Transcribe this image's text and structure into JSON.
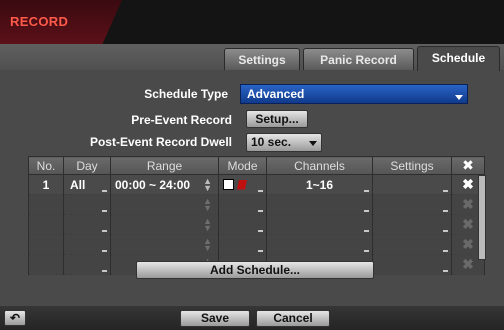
{
  "window": {
    "title": "RECORD"
  },
  "tabs": [
    {
      "label": "Settings"
    },
    {
      "label": "Panic Record"
    },
    {
      "label": "Schedule"
    }
  ],
  "form": {
    "schedule_type_label": "Schedule Type",
    "schedule_type_value": "Advanced",
    "pre_event_label": "Pre-Event Record",
    "pre_event_button": "Setup...",
    "post_event_label": "Post-Event Record Dwell",
    "post_event_value": "10 sec."
  },
  "table": {
    "columns": [
      "No.",
      "Day",
      "Range",
      "Mode",
      "Channels",
      "Settings"
    ],
    "delete_icon": "close-icon",
    "rows": [
      {
        "no": "1",
        "day": "All",
        "range": "00:00 ~ 24:00",
        "mode": [
          "record-mode-icon",
          "event-mode-icon"
        ],
        "channels": "1~16",
        "settings": ""
      }
    ],
    "empty_rows": 4
  },
  "add_schedule_label": "Add Schedule...",
  "footer": {
    "back_icon": "back-icon",
    "save_label": "Save",
    "cancel_label": "Cancel"
  },
  "colors": {
    "title_accent": "#ff5a4a",
    "dropdown_blue": "#2a64c6",
    "panel": "#4a4a4a"
  }
}
